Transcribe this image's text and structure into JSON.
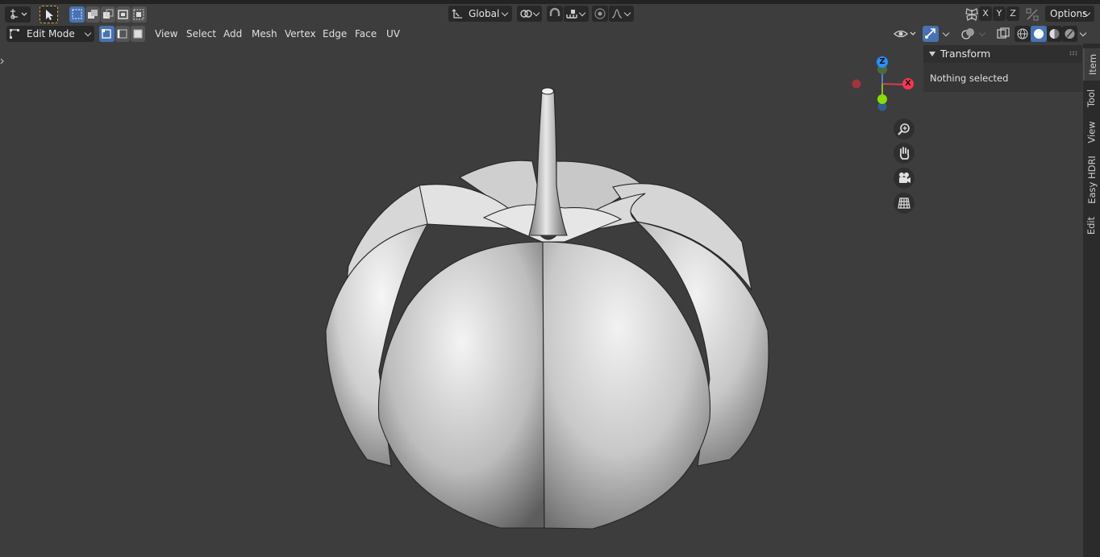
{
  "header": {
    "transform_orientation": "Global",
    "axis_labels": [
      "X",
      "Y",
      "Z"
    ],
    "options_label": "Options"
  },
  "toolbar": {
    "mode_label": "Edit Mode",
    "menus": [
      "View",
      "Select",
      "Add",
      "Mesh",
      "Vertex",
      "Edge",
      "Face",
      "UV"
    ]
  },
  "sidebar": {
    "tabs": [
      "Item",
      "Tool",
      "View",
      "Easy HDRI",
      "Edit"
    ],
    "active_tab": "Item",
    "panel_title": "Transform",
    "panel_text": "Nothing selected"
  },
  "gizmo": {
    "x_label": "X",
    "z_label": "Z",
    "nav_icons": [
      "zoom-icon",
      "hand-pan-icon",
      "camera-icon",
      "grid-ortho-icon"
    ]
  },
  "colors": {
    "accent": "#4772b3",
    "x_axis": "#ff3352",
    "y_axis": "#8bdc00",
    "z_axis": "#2890ff",
    "viewport_bg": "#3d3d3d"
  }
}
